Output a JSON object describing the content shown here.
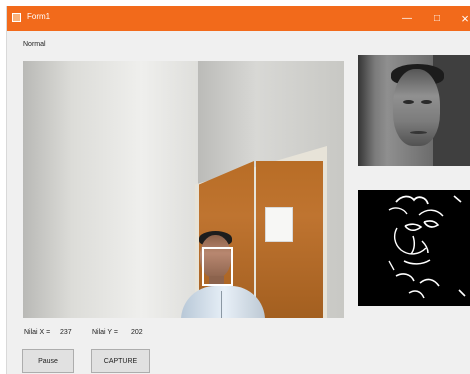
{
  "window": {
    "title": "Form1",
    "controls": {
      "minimize": "—",
      "maximize": "□",
      "close": "×"
    }
  },
  "status": {
    "mode": "Normal"
  },
  "coordinates": {
    "x_label": "Nilai X =",
    "x_value": "237",
    "y_label": "Nilai Y =",
    "y_value": "202"
  },
  "buttons": {
    "pause": "Pause",
    "capture": "CAPTURE"
  },
  "colors": {
    "titlebar": "#f26a1b",
    "face_box": "#ffffff"
  }
}
